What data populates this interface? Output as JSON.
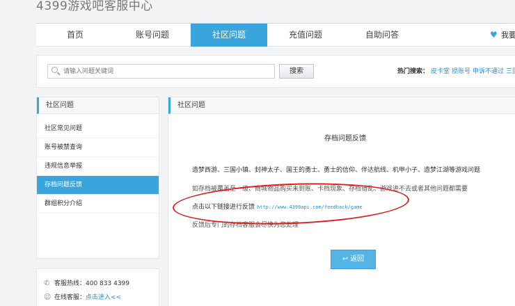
{
  "site": {
    "title": "4399游戏吧客服中心"
  },
  "nav": {
    "tabs": [
      {
        "label": "首页"
      },
      {
        "label": "账号问题"
      },
      {
        "label": "社区问题"
      },
      {
        "label": "充值问题"
      },
      {
        "label": "自助问答"
      }
    ],
    "right_text": "我要",
    "active_tab": "社区问题"
  },
  "search": {
    "placeholder": "请输入问题关键词",
    "button": "搜索",
    "hot_label": "热门搜索：",
    "hot_links": [
      "皮卡堂",
      "损账号",
      "申诉不通过",
      "三国"
    ]
  },
  "sidebar": {
    "title": "社区问题",
    "items": [
      {
        "label": "社区常见问题"
      },
      {
        "label": "账号被禁查询"
      },
      {
        "label": "违规信息举报"
      },
      {
        "label": "存档问题反馈"
      },
      {
        "label": "群组积分介绍"
      }
    ],
    "active_item": "存档问题反馈"
  },
  "contact": {
    "hotline_label": "客服热线：",
    "hotline": "400 833 4399",
    "online_label": "在线客服：",
    "online_link": "点击进入<<"
  },
  "main": {
    "header": "社区问题",
    "title": "存档问题反馈",
    "line1": "造梦西游、三国小镇、封神太子、国王的勇士、勇士的信仰、伴达航线、机甲小子、造梦江湖等游戏问题",
    "line2": "如存档被覆盖至一级、商城物品购买未到账、卡档现象、存档错乱、游戏进不去或者其他问题都需要",
    "line3_text": "点击以下链接进行反馈",
    "line3_link": "http://www.4399api.com/feedback/game",
    "line4": "反馈后专门的存档客服会尽快为您处理",
    "back_button": "返回"
  },
  "colors": {
    "accent": "#3aa4dc",
    "annotation": "#e01e1e"
  }
}
